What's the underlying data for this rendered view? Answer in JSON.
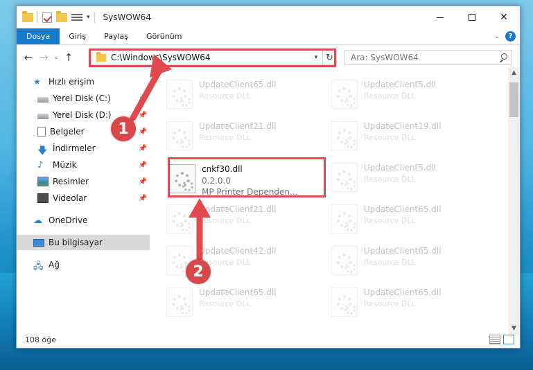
{
  "window": {
    "title": "SysWOW64",
    "controls": {
      "minimize": "—",
      "maximize": "☐",
      "close": "✕"
    }
  },
  "ribbon": {
    "tabs": [
      "Dosya",
      "Giriş",
      "Paylaş",
      "Görünüm"
    ],
    "help": "?"
  },
  "navigation": {
    "back": "←",
    "forward": "→",
    "recent": "⌄",
    "up": "↑",
    "address": "C:\\Windows\\SysWOW64",
    "search_placeholder": "Ara: SysWOW64"
  },
  "sidebar": {
    "items": [
      {
        "label": "Hızlı erişim",
        "icon": "star-icon",
        "pinned": false
      },
      {
        "label": "Yerel Disk (C:)",
        "icon": "drive-icon",
        "pinned": true
      },
      {
        "label": "Yerel Disk (D:)",
        "icon": "drive-icon",
        "pinned": true
      },
      {
        "label": "Belgeler",
        "icon": "documents-icon",
        "pinned": true
      },
      {
        "label": "İndirmeler",
        "icon": "download-icon",
        "pinned": true
      },
      {
        "label": "Müzik",
        "icon": "music-icon",
        "pinned": true
      },
      {
        "label": "Resimler",
        "icon": "pictures-icon",
        "pinned": true
      },
      {
        "label": "Videolar",
        "icon": "videos-icon",
        "pinned": true
      },
      {
        "label": "OneDrive",
        "icon": "cloud-icon",
        "pinned": false
      },
      {
        "label": "Bu bilgisayar",
        "icon": "pc-icon",
        "pinned": false,
        "selected": true
      },
      {
        "label": "Ağ",
        "icon": "network-icon",
        "pinned": false
      }
    ]
  },
  "files": {
    "col1": [
      {
        "name": "UpdateClient65.dll",
        "desc": "Resource DLL"
      },
      {
        "name": "UpdateClient21.dll",
        "desc": "Resource DLL"
      },
      {
        "name": "UpdateClient21.dll",
        "desc": "Resource DLL"
      },
      {
        "name": "UpdateClient42.dll",
        "desc": "Resource DLL"
      },
      {
        "name": "UpdateClient65.dll",
        "desc": "Resource DLL"
      }
    ],
    "col2": [
      {
        "name": "UpdateClient5.dll",
        "desc": "Resource DLL"
      },
      {
        "name": "UpdateClient19.dll",
        "desc": "Resource DLL"
      },
      {
        "name": "UpdateClient5.dll",
        "desc": "Resource DLL"
      },
      {
        "name": "UpdateClient65.dll",
        "desc": "Resource DLL"
      },
      {
        "name": "UpdateClient65.dll",
        "desc": "Resource DLL"
      },
      {
        "name": "UpdateClient65.dll",
        "desc": "Resource DLL"
      }
    ],
    "main": {
      "name": "cnkf30.dll",
      "version": "0.2.0.0",
      "desc": "MP Printer Dependen..."
    }
  },
  "status": {
    "count": "108 öğe"
  },
  "annotations": {
    "step1": "1",
    "step2": "2",
    "color": "#e04a4f"
  }
}
